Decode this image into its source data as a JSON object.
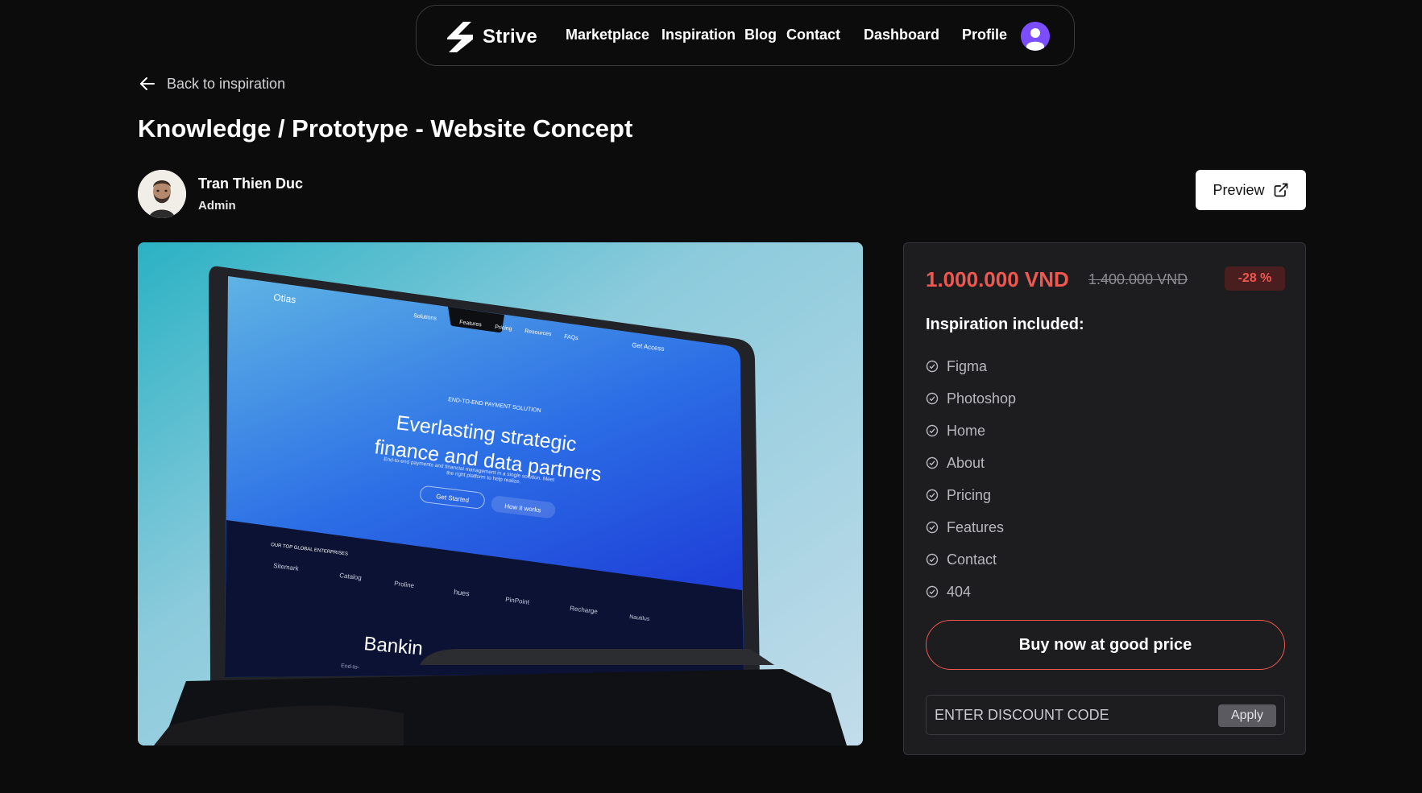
{
  "nav": {
    "brand": "Strive",
    "links": [
      "Marketplace",
      "Inspiration",
      "Blog",
      "Contact",
      "Dashboard",
      "Profile"
    ]
  },
  "back_label": "Back to inspiration",
  "page_title": "Knowledge / Prototype - Website Concept",
  "author": {
    "name": "Tran Thien Duc",
    "role": "Admin"
  },
  "preview_label": "Preview",
  "mockup": {
    "logo": "Otias",
    "nav_items": [
      "Solutions",
      "Features",
      "Pricing",
      "Resources",
      "FAQs"
    ],
    "cta": "Get Access",
    "badge": "END-TO-END PAYMENT SOLUTION",
    "headline_1": "Everlasting strategic",
    "headline_2": "finance and data partners",
    "sub_1": "End-to-end payments and financial management in a single solution. Meet",
    "sub_2": "the right platform to help realize.",
    "btn_primary": "Get Started",
    "btn_secondary": "How it works",
    "enterprises_label": "OUR TOP GLOBAL ENTERPRISES",
    "logos": [
      "Sitemark",
      "Catalog",
      "Proline",
      "hues",
      "PinPoint",
      "Recharge",
      "Nautilus"
    ],
    "section_title": "Bankin",
    "section_sub": "End-to-"
  },
  "pricing": {
    "price": "1.000.000 VND",
    "old_price": "1.400.000 VND",
    "discount": "-28 %",
    "included_title": "Inspiration included:",
    "features": [
      "Figma",
      "Photoshop",
      "Home",
      "About",
      "Pricing",
      "Features",
      "Contact",
      "404"
    ],
    "buy_label": "Buy now at good price",
    "discount_placeholder": "ENTER DISCOUNT CODE",
    "apply_label": "Apply"
  },
  "colors": {
    "background": "#0c0c0d",
    "card": "#1d1d20",
    "accent": "#f0584f",
    "avatar": "#7c4dff"
  },
  "icons": [
    "strive-logo-icon",
    "arrow-left-icon",
    "external-link-icon",
    "check-badge-icon",
    "user-avatar-icon"
  ]
}
